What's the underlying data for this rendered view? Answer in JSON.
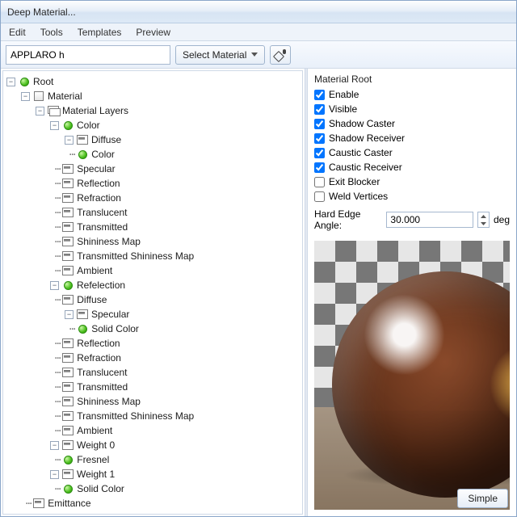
{
  "window": {
    "title": "Deep Material..."
  },
  "menu": [
    "Edit",
    "Tools",
    "Templates",
    "Preview"
  ],
  "toolbar": {
    "name_value": "APPLARO h",
    "select_label": "Select Material",
    "eyedrop": "eyedropper-icon"
  },
  "tree": {
    "root": "Root",
    "material": "Material",
    "material_layers": "Material Layers",
    "color": "Color",
    "color_children": {
      "diffuse": "Diffuse",
      "diffuse_color": "Color",
      "specular": "Specular",
      "reflection": "Reflection",
      "refraction": "Refraction",
      "translucent": "Translucent",
      "transmitted": "Transmitted",
      "shininess_map": "Shininess Map",
      "trans_shininess": "Transmitted Shininess Map",
      "ambient": "Ambient"
    },
    "refelection": "Refelection",
    "refel_children": {
      "diffuse": "Diffuse",
      "specular": "Specular",
      "specular_solid": "Solid Color",
      "reflection": "Reflection",
      "refraction": "Refraction",
      "translucent": "Translucent",
      "transmitted": "Transmitted",
      "shininess_map": "Shininess Map",
      "trans_shininess": "Transmitted Shininess Map",
      "ambient": "Ambient"
    },
    "weight0": "Weight 0",
    "weight0_fresnel": "Fresnel",
    "weight1": "Weight 1",
    "weight1_solid": "Solid Color",
    "emittance": "Emittance"
  },
  "panel": {
    "title": "Material Root",
    "checks": {
      "enable": "Enable",
      "visible": "Visible",
      "shadow_caster": "Shadow Caster",
      "shadow_receiver": "Shadow Receiver",
      "caustic_caster": "Caustic Caster",
      "caustic_receiver": "Caustic Receiver",
      "exit_blocker": "Exit Blocker",
      "weld_vertices": "Weld Vertices"
    },
    "hard_edge_label": "Hard Edge Angle:",
    "hard_edge_value": "30.000",
    "hard_edge_unit": "deg"
  },
  "preview": {
    "simple_button": "Simple"
  }
}
